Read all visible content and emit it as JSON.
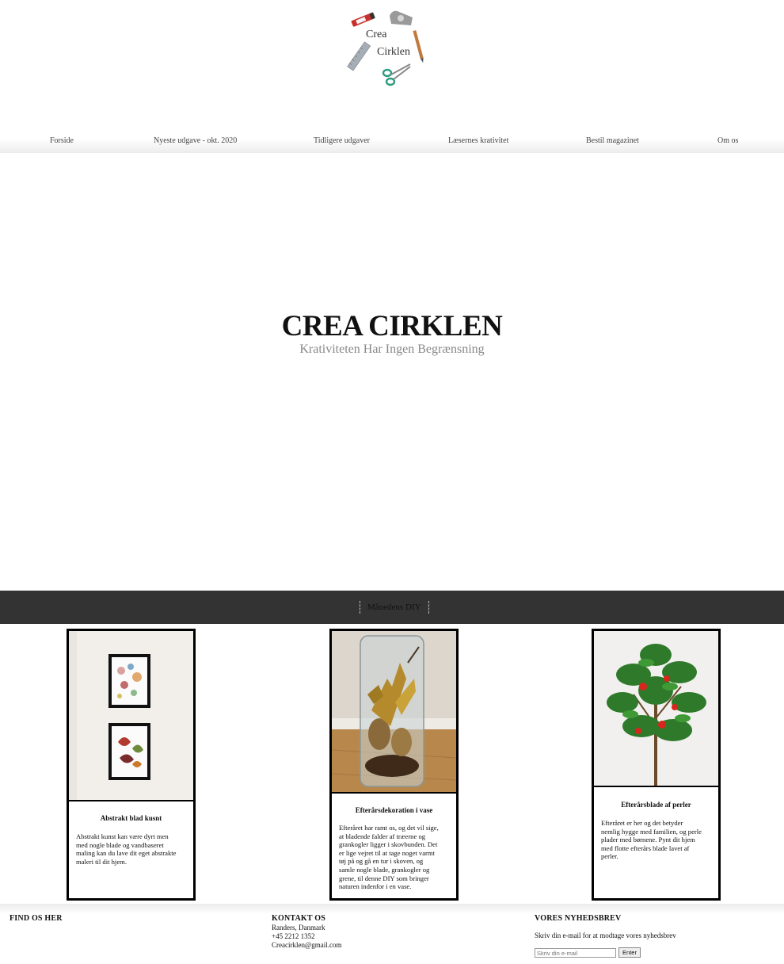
{
  "logo": {
    "line1": "Crea",
    "line2": "Cirklen"
  },
  "nav": {
    "items": [
      {
        "label": "Forside"
      },
      {
        "label": "Nyeste udgave - okt. 2020"
      },
      {
        "label": "Tidligere udgaver"
      },
      {
        "label": "Læsernes krativitet"
      },
      {
        "label": "Bestil magazinet"
      },
      {
        "label": "Om os"
      }
    ]
  },
  "hero": {
    "title": "CREA CIRKLEN",
    "subtitle": "Krativiteten Har Ingen Begrænsning"
  },
  "section": {
    "heading": "Månedens DIY"
  },
  "cards": [
    {
      "title": "Abstrakt blad kusnt",
      "lines": [
        "Abstrakt kunst kan være dyrt men",
        "med nogle blade og vandbaseret",
        "maling kan du lave dit eget abstrakte",
        "maleri til dit hjem."
      ]
    },
    {
      "title": "Efterårsdekoration i vase",
      "lines": [
        "Efteråret har ramt os, og det vil sige,",
        "at bladende falder af træerne og",
        "grankogler ligger i skovbunden. Det",
        "er lige vejret til at tage noget varmt",
        "tøj på og gå en tur i skoven, og",
        "samle nogle blade, grankogler og",
        "grene, til denne DIY som bringer",
        "naturen indenfor i en vase."
      ]
    },
    {
      "title": "Efterårsblade af perler",
      "lines": [
        "Efteråret er her og det betyder",
        "nemlig hygge med familien, og perle",
        "plader med børnene. Pynt dit hjem",
        "med flotte efterårs blade lavet af",
        "perler."
      ]
    }
  ],
  "footer": {
    "find": {
      "heading": "FIND OS HER"
    },
    "contact": {
      "heading": "KONTAKT OS",
      "address": "Randers, Danmark",
      "phone": "+45 2212 1352",
      "email": "Creacirklen@gmail.com"
    },
    "newsletter": {
      "heading": "VORES NYHEDSBREV",
      "text": "Skriv din e-mail for at modtage vores nyhedsbrev",
      "placeholder": "Skriv din e-mail",
      "button": "Enter"
    }
  }
}
